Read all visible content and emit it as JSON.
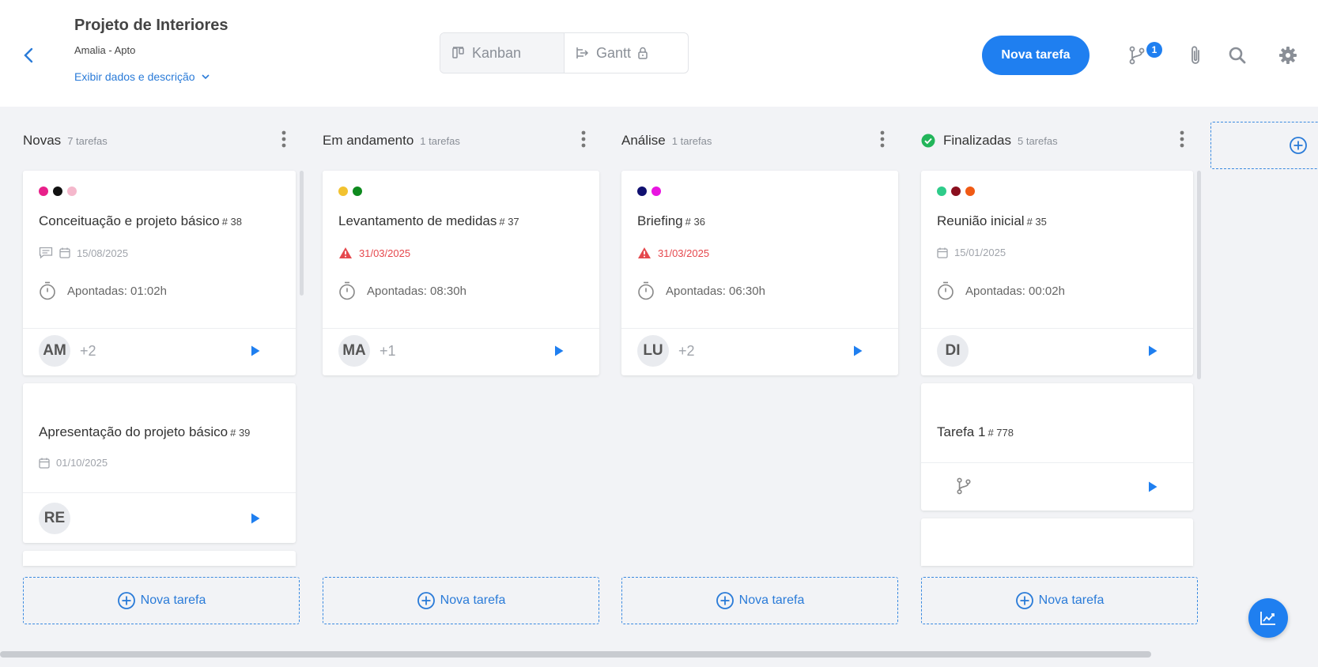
{
  "header": {
    "project_title": "Projeto de Interiores",
    "project_subtitle": "Amalia - Apto",
    "details_link": "Exibir dados e descrição",
    "views": [
      {
        "label": "Kanban",
        "icon": "kanban-icon",
        "active": true
      },
      {
        "label": "Gantt",
        "icon": "gantt-icon",
        "locked": true
      }
    ],
    "new_task_label": "Nova tarefa",
    "branch_badge": "1"
  },
  "columns": [
    {
      "name": "Novas",
      "count": "7 tarefas",
      "cards": [
        {
          "dots": [
            "#e8208a",
            "#111111",
            "#f5b8cc"
          ],
          "title": "Conceituação e projeto básico",
          "number": "# 38",
          "has_comments": true,
          "date": "15/08/2025",
          "overdue": false,
          "hours": "Apontadas: 01:02h",
          "avatar": "AM",
          "more": "+2"
        },
        {
          "dots": [],
          "title": "Apresentação do projeto básico",
          "number": "# 39",
          "date": "01/10/2025",
          "overdue": false,
          "avatar": "RE"
        }
      ],
      "add_label": "Nova tarefa"
    },
    {
      "name": "Em andamento",
      "count": "1 tarefas",
      "cards": [
        {
          "dots": [
            "#f2c230",
            "#0e8a1e"
          ],
          "title": "Levantamento de medidas",
          "number": "# 37",
          "date": "31/03/2025",
          "overdue": true,
          "hours": "Apontadas: 08:30h",
          "avatar": "MA",
          "more": "+1"
        }
      ],
      "add_label": "Nova tarefa"
    },
    {
      "name": "Análise",
      "count": "1 tarefas",
      "cards": [
        {
          "dots": [
            "#101070",
            "#e815e0"
          ],
          "title": "Briefing",
          "number": "# 36",
          "date": "31/03/2025",
          "overdue": true,
          "hours": "Apontadas: 06:30h",
          "avatar": "LU",
          "more": "+2"
        }
      ],
      "add_label": "Nova tarefa"
    },
    {
      "name": "Finalizadas",
      "count": "5 tarefas",
      "done": true,
      "cards": [
        {
          "dots": [
            "#2ecc8a",
            "#8a0f1e",
            "#f05a14"
          ],
          "title": "Reunião inicial",
          "number": "# 35",
          "date": "15/01/2025",
          "overdue": false,
          "hours": "Apontadas: 00:02h",
          "avatar": "DI"
        },
        {
          "dots": [],
          "title": "Tarefa 1",
          "number": "# 778",
          "subtask": true
        }
      ],
      "add_label": "Nova tarefa"
    }
  ],
  "colors": {
    "accent": "#1f7ff0",
    "overdue": "#e5484d",
    "done": "#22b55a"
  }
}
